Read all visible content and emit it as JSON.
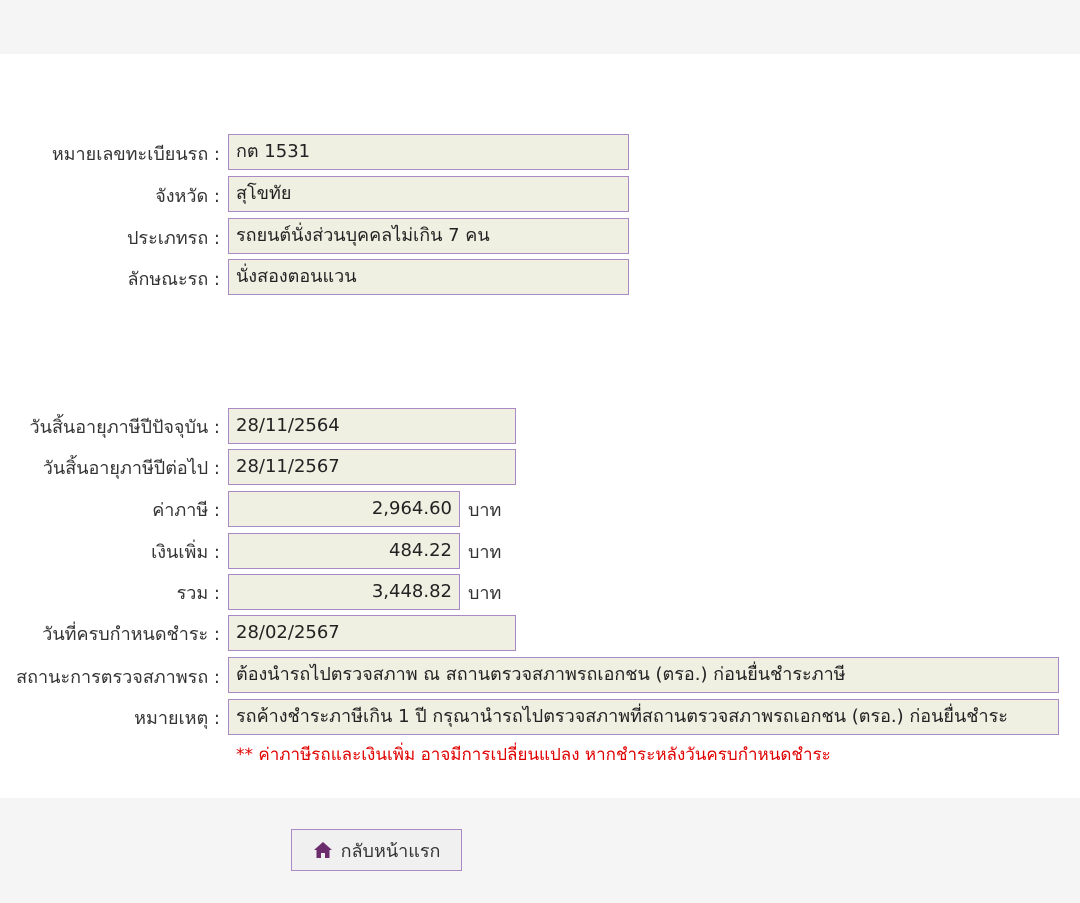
{
  "vehicle": {
    "plate_label": "หมายเลขทะเบียนรถ :",
    "plate_value": "กต 1531",
    "province_label": "จังหวัด :",
    "province_value": "สุโขทัย",
    "type_label": "ประเภทรถ :",
    "type_value": "รถยนต์นั่งส่วนบุคคลไม่เกิน 7 คน",
    "body_label": "ลักษณะรถ :",
    "body_value": "นั่งสองตอนแวน"
  },
  "tax": {
    "current_expiry_label": "วันสิ้นอายุภาษีปีปัจจุบัน :",
    "current_expiry_value": "28/11/2564",
    "next_expiry_label": "วันสิ้นอายุภาษีปีต่อไป :",
    "next_expiry_value": "28/11/2567",
    "fee_label": "ค่าภาษี :",
    "fee_value": "2,964.60",
    "surcharge_label": "เงินเพิ่ม :",
    "surcharge_value": "484.22",
    "total_label": "รวม :",
    "total_value": "3,448.82",
    "unit": "บาท",
    "due_label": "วันที่ครบกำหนดชำระ :",
    "due_value": "28/02/2567",
    "inspection_label": "สถานะการตรวจสภาพรถ :",
    "inspection_value": "ต้องนำรถไปตรวจสภาพ ณ สถานตรวจสภาพรถเอกชน (ตรอ.) ก่อนยื่นชำระภาษี",
    "remark_label": "หมายเหตุ :",
    "remark_value": "รถค้างชำระภาษีเกิน 1 ปี กรุณานำรถไปตรวจสภาพที่สถานตรวจสภาพรถเอกชน (ตรอ.) ก่อนยื่นชำระ",
    "warning": "** ค่าภาษีรถและเงินเพิ่ม อาจมีการเปลี่ยนแปลง หากชำระหลังวันครบกำหนดชำระ"
  },
  "actions": {
    "home_label": "กลับหน้าแรก",
    "home_icon": "home-icon"
  },
  "colors": {
    "field_border": "#a98ac4",
    "field_bg": "#efefe2",
    "warning": "#e00000",
    "icon": "#6b2d6b"
  }
}
